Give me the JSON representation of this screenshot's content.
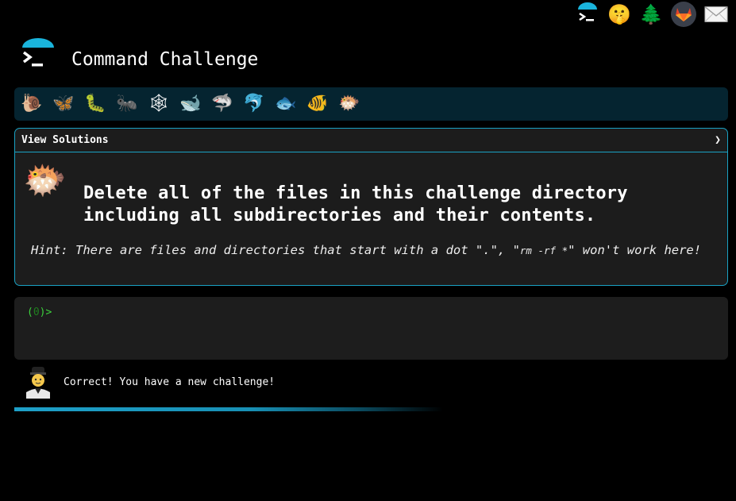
{
  "header": {
    "title": "Command Challenge",
    "top_icons": [
      "terminal-umbrella-icon",
      "shushing-face-icon",
      "evergreen-tree-icon",
      "gitlab-icon",
      "envelope-icon"
    ]
  },
  "badges": [
    {
      "name": "snail-icon",
      "glyph": "🐌"
    },
    {
      "name": "butterfly-icon",
      "glyph": "🦋"
    },
    {
      "name": "caterpillar-icon",
      "glyph": "🐛"
    },
    {
      "name": "ant-icon",
      "glyph": "🐜"
    },
    {
      "name": "spider-web-icon",
      "glyph": "🕸"
    },
    {
      "name": "whale-icon",
      "glyph": "🐋"
    },
    {
      "name": "shark-icon",
      "glyph": "🦈"
    },
    {
      "name": "dolphin-icon",
      "glyph": "🐬"
    },
    {
      "name": "fish-icon",
      "glyph": "🐟"
    },
    {
      "name": "tropical-fish-icon",
      "glyph": "🐠"
    },
    {
      "name": "blowfish-icon",
      "glyph": "🐡"
    }
  ],
  "challenge": {
    "view_solutions_label": "View Solutions",
    "chevron": "❯",
    "task_line1": "Delete all of the files in this challenge directory",
    "task_line2": "including all subdirectories and their contents.",
    "hint_before": "Hint: There are files and directories that start with a dot \".\", \"",
    "hint_code": "rm -rf *",
    "hint_after": "\" won't work here!"
  },
  "terminal": {
    "prompt_open": "(",
    "prompt_count": "0",
    "prompt_close": ")>",
    "input_value": ""
  },
  "feedback": {
    "message": "Correct! You have a new challenge!"
  },
  "progress": {
    "fraction": 0.55
  },
  "colors": {
    "accent": "#1aa2c4",
    "badge_bar_bg": "#052430",
    "prompt_green": "#3cd03c"
  }
}
